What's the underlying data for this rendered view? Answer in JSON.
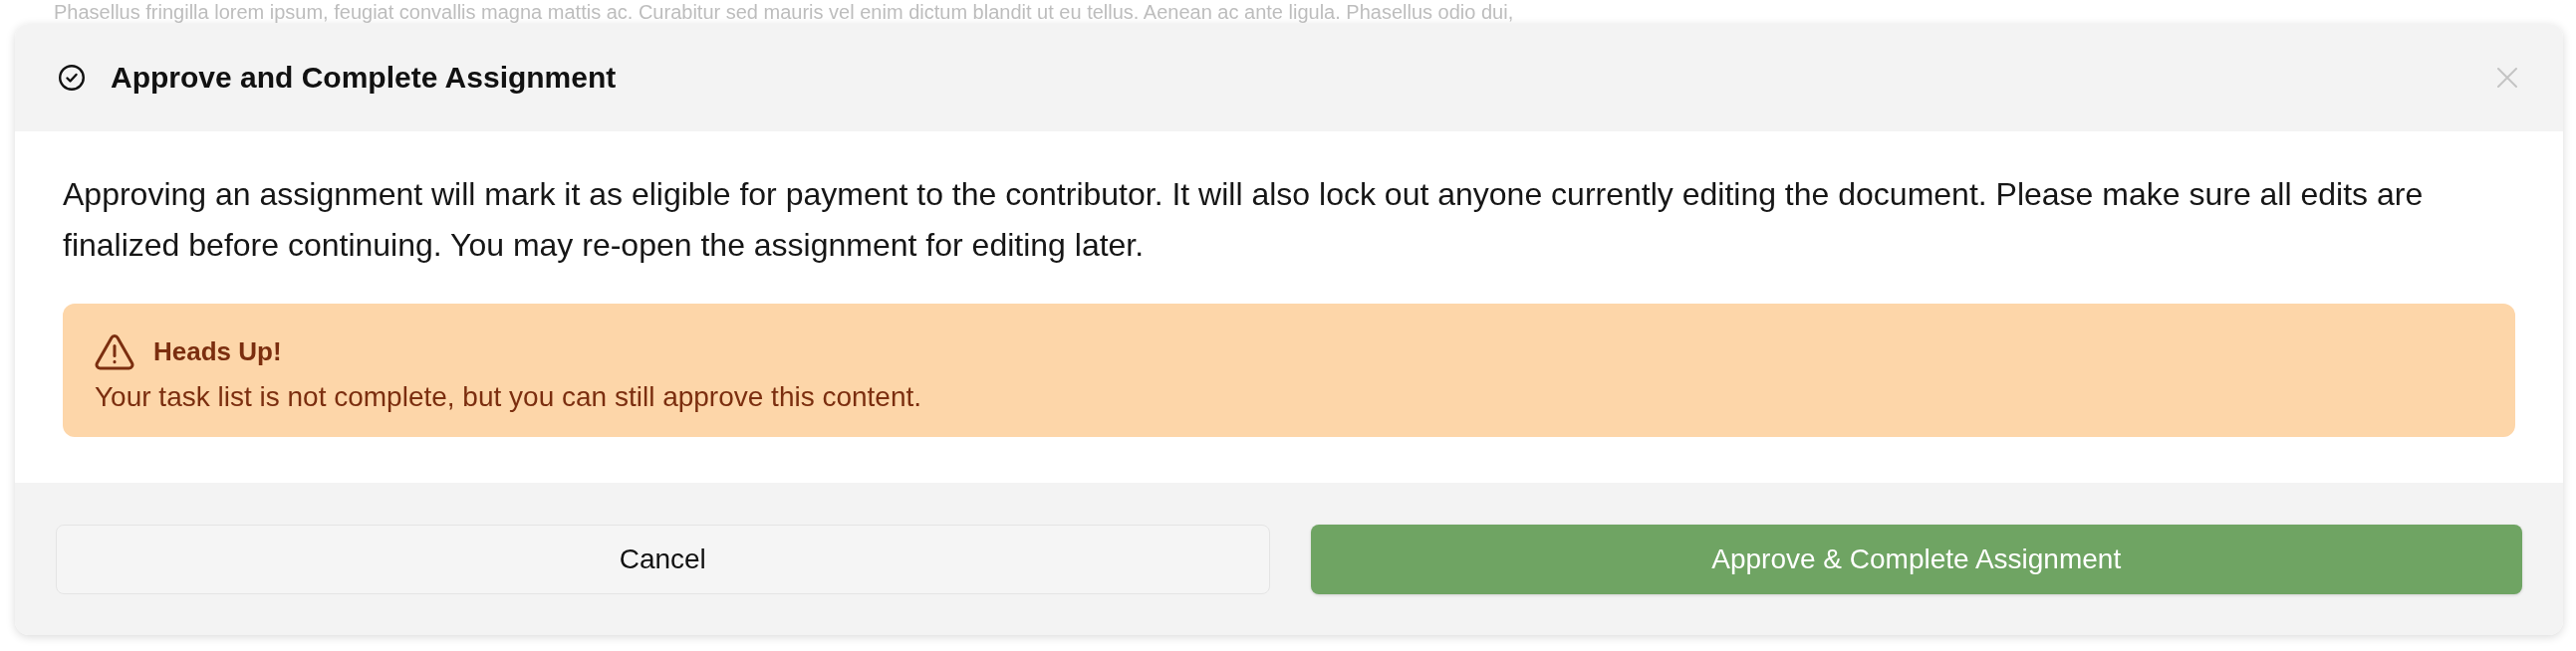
{
  "background_text": "Phasellus fringilla lorem ipsum, feugiat convallis magna mattis ac. Curabitur sed mauris vel enim dictum blandit ut eu tellus. Aenean ac ante ligula. Phasellus odio dui,",
  "dialog": {
    "title": "Approve and Complete Assignment",
    "message": "Approving an assignment will mark it as eligible for payment to the contributor. It will also lock out anyone currently editing the document. Please make sure all edits are finalized before continuing. You may re-open the assignment for editing later.",
    "alert": {
      "kind": "warning",
      "title": "Heads Up!",
      "message": "Your task list is not complete, but you can still approve this content."
    },
    "buttons": [
      {
        "label": "Cancel",
        "kind": "secondary"
      },
      {
        "label": "Approve & Complete Assignment",
        "kind": "primary"
      }
    ]
  }
}
